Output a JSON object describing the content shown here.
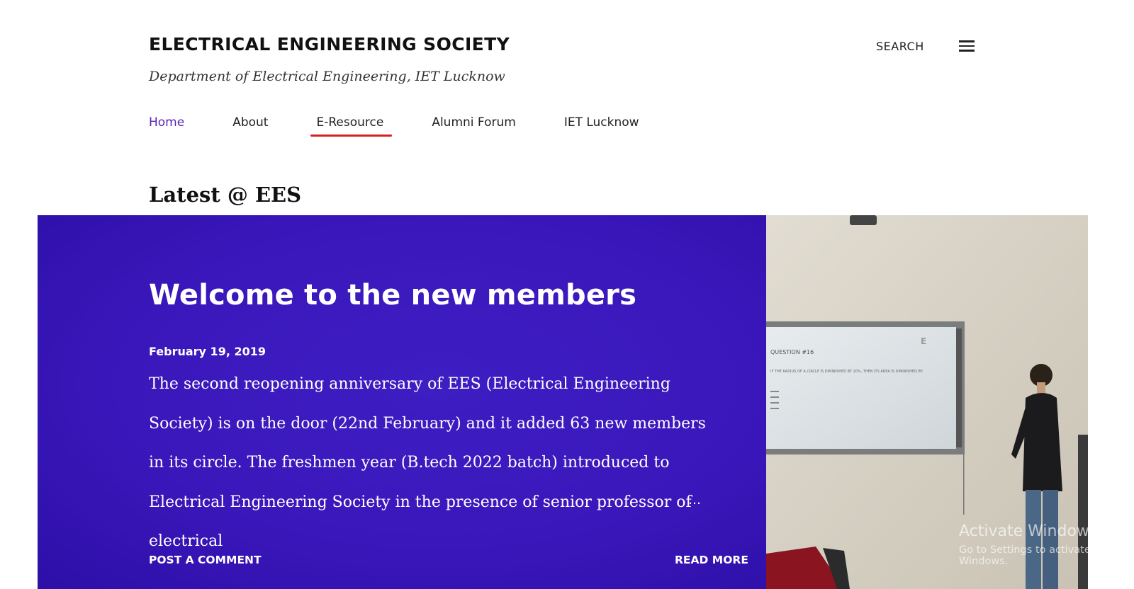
{
  "header": {
    "title": "ELECTRICAL ENGINEERING SOCIETY",
    "description": "Department of Electrical Engineering, IET Lucknow",
    "search_label": "SEARCH",
    "menu_icon": "hamburger-menu-icon"
  },
  "nav": {
    "items": [
      {
        "label": "Home"
      },
      {
        "label": "About"
      },
      {
        "label": "E-Resource"
      },
      {
        "label": "Alumni Forum"
      },
      {
        "label": "IET Lucknow"
      }
    ],
    "active_color": "#5b24b5",
    "annotation_color": "#d8201f"
  },
  "section": {
    "title": "Latest @ EES"
  },
  "featured_post": {
    "title": "Welcome to the new members",
    "date": "February 19, 2019",
    "snippet": "The second reopening anniversary of EES (Electrical Engineering Society) is on the door (22nd February) and it added 63 new members in its circle. The freshmen year (B.tech 2022 batch) introduced to Electrical Engineering Society in the presence of senior professor of electrical",
    "ellipsis": "…",
    "comment_label": "POST A COMMENT",
    "read_more_label": "READ MORE",
    "background_color": "#3a17bb",
    "image": {
      "screen_heading": "QUESTION #16",
      "screen_text": "IF THE RADIUS OF A CIRCLE IS DIMINISHED BY 10%, THEN ITS AREA IS DIMINISHED BY:",
      "screen_logo": "E"
    }
  },
  "watermark": {
    "line1": "Activate Windows",
    "line2": "Go to Settings to activate Windows."
  }
}
